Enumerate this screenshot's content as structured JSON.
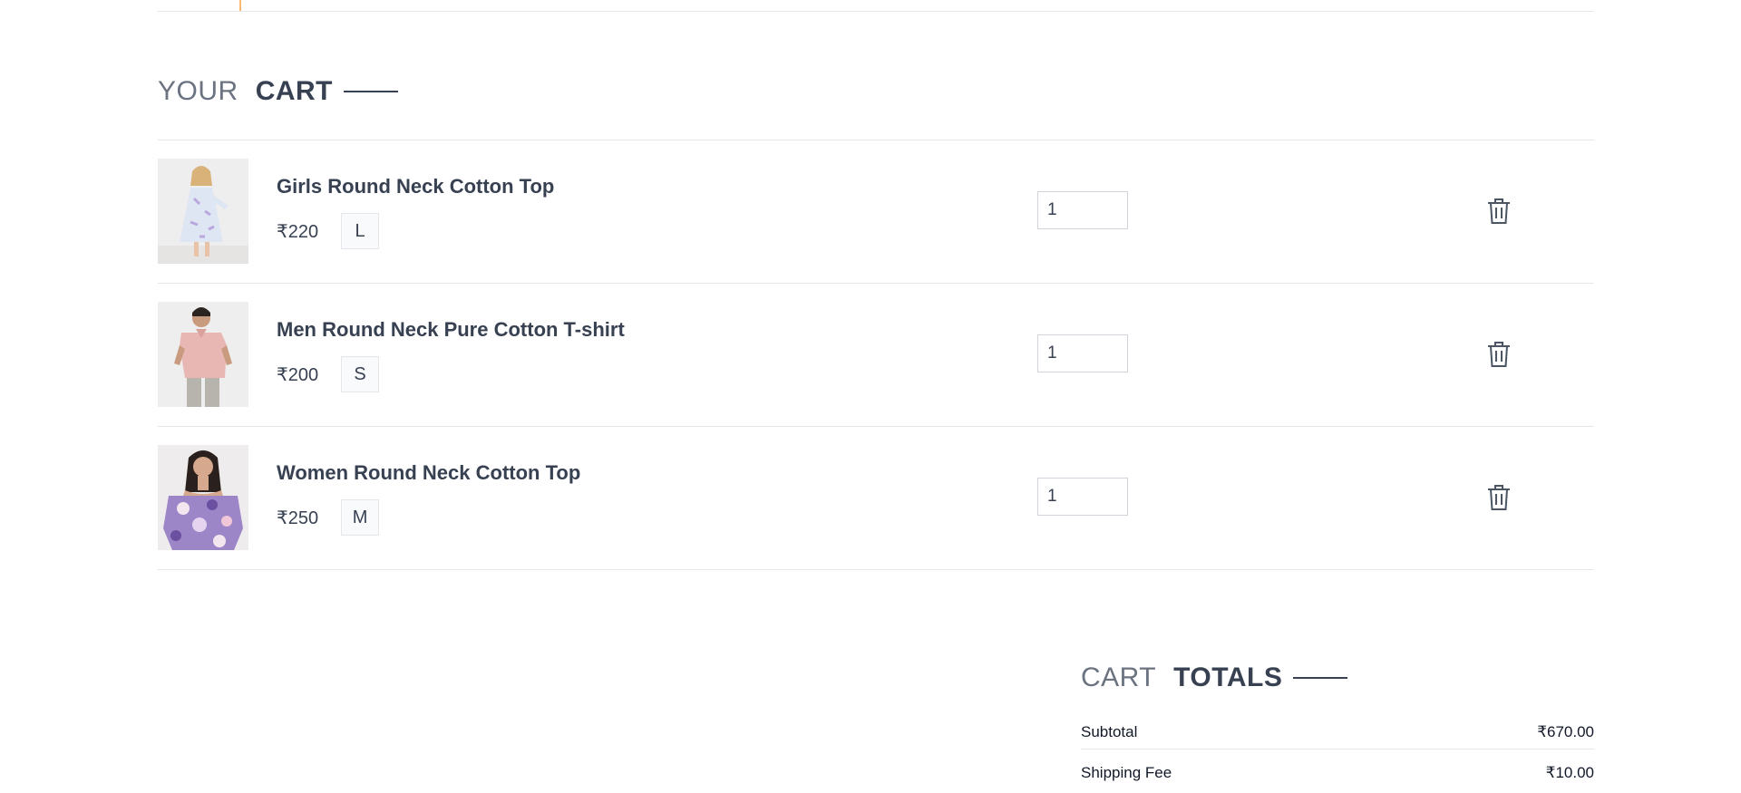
{
  "cart_heading": {
    "muted": "YOUR",
    "strong": "CART"
  },
  "cart_items": [
    {
      "name": "Girls Round Neck Cotton Top",
      "price": "₹220",
      "size": "L",
      "quantity": "1"
    },
    {
      "name": "Men Round Neck Pure Cotton T-shirt",
      "price": "₹200",
      "size": "S",
      "quantity": "1"
    },
    {
      "name": "Women Round Neck Cotton Top",
      "price": "₹250",
      "size": "M",
      "quantity": "1"
    }
  ],
  "totals_heading": {
    "muted": "CART",
    "strong": "TOTALS"
  },
  "totals": {
    "subtotal_label": "Subtotal",
    "subtotal_value": "₹670.00",
    "shipping_label": "Shipping Fee",
    "shipping_value": "₹10.00"
  },
  "icons": {
    "delete": "trash-icon"
  },
  "colors": {
    "text": "#374151",
    "muted": "#6b7280",
    "border": "#e5e7eb",
    "badge_bg": "#f8fafc",
    "accent_rule": "#fdba74"
  }
}
